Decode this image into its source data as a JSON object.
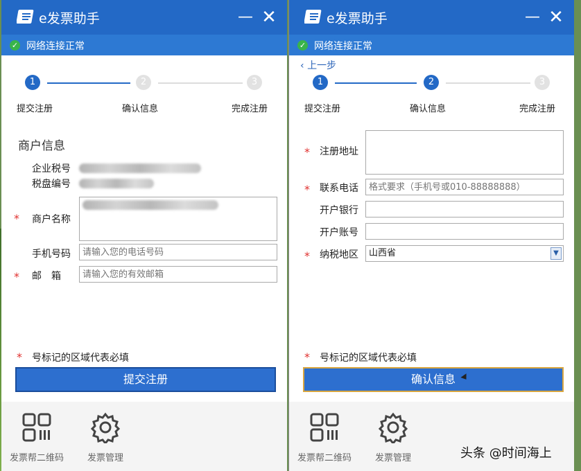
{
  "app": {
    "title": "e发票助手"
  },
  "status": {
    "text": "网络连接正常"
  },
  "steps": [
    "提交注册",
    "确认信息",
    "完成注册"
  ],
  "left": {
    "section_title": "商户信息",
    "tax_id_label": "企业税号",
    "disk_label": "税盘编号",
    "merchant_label": "商户名称",
    "phone_label": "手机号码",
    "phone_placeholder": "请输入您的电话号码",
    "email_label": "邮　箱",
    "email_placeholder": "请输入您的有效邮箱",
    "required_note": "号标记的区域代表必填",
    "submit_label": "提交注册"
  },
  "right": {
    "back_label": "上一步",
    "address_label": "注册地址",
    "phone_label": "联系电话",
    "phone_placeholder": "格式要求（手机号或010-88888888）",
    "bank_label": "开户银行",
    "account_label": "开户账号",
    "region_label": "纳税地区",
    "region_value": "山西省",
    "required_note": "号标记的区域代表必填",
    "confirm_label": "确认信息"
  },
  "footer": {
    "qr_label": "发票帮二维码",
    "manage_label": "发票管理"
  },
  "watermark": "头条 @时间海上",
  "step_numbers": [
    "1",
    "2",
    "3"
  ],
  "colors": {
    "primary": "#2369c6",
    "status_ok": "#39b44a",
    "required": "#e0312f"
  }
}
